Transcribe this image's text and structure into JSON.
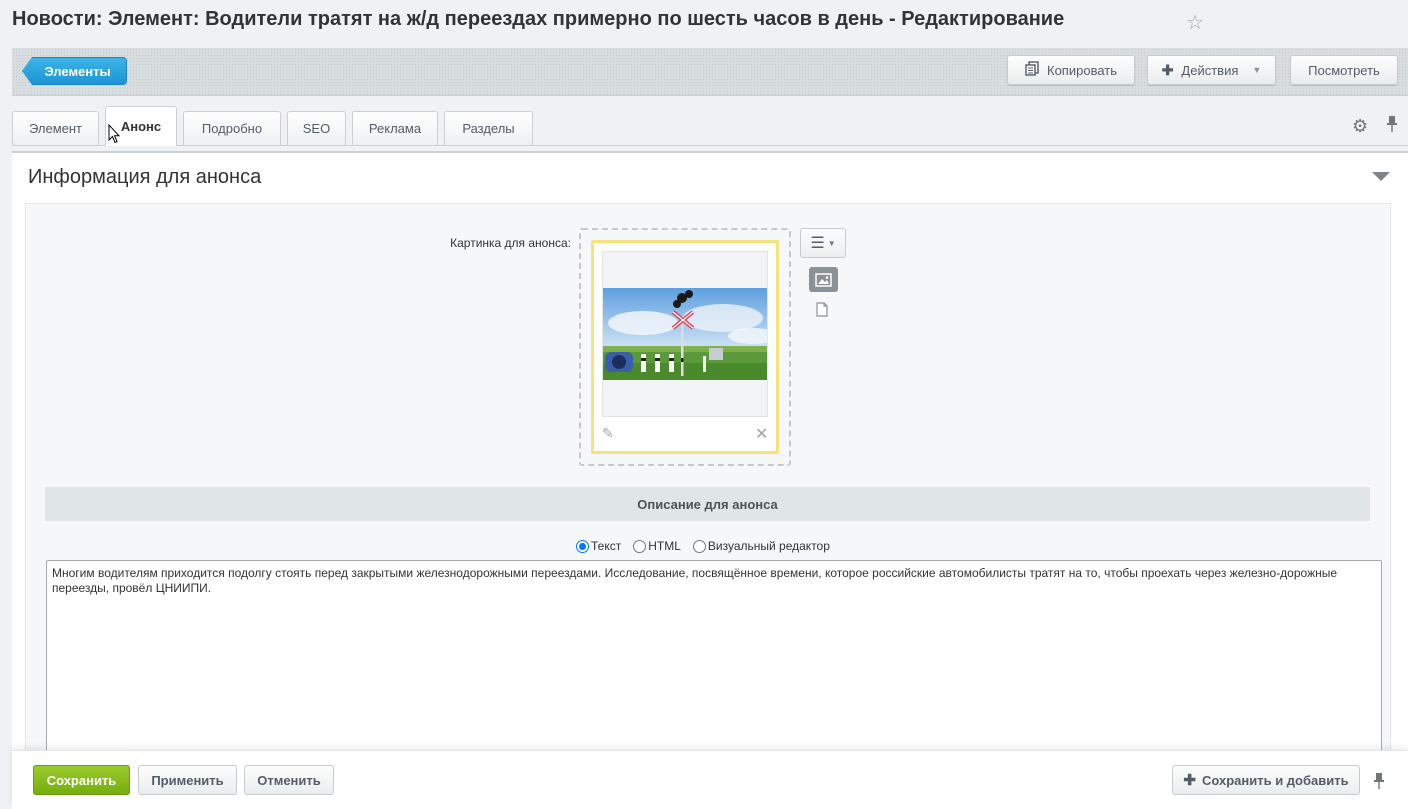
{
  "page": {
    "title": "Новости: Элемент: Водители тратят на ж/д переездах примерно по шесть часов в день - Редактирование",
    "favorite_icon": "star-icon"
  },
  "toolbar": {
    "elements_label": "Элементы",
    "copy_label": "Копировать",
    "actions_label": "Действия",
    "view_label": "Посмотреть"
  },
  "tabs": [
    {
      "label": "Элемент",
      "active": false
    },
    {
      "label": "Анонс",
      "active": true
    },
    {
      "label": "Подробно",
      "active": false
    },
    {
      "label": "SEO",
      "active": false
    },
    {
      "label": "Реклама",
      "active": false
    },
    {
      "label": "Разделы",
      "active": false
    }
  ],
  "section": {
    "title": "Информация для анонса",
    "picture_label": "Картинка для анонса:",
    "description_header": "Описание для анонса",
    "editor_modes": [
      {
        "label": "Текст",
        "checked": true
      },
      {
        "label": "HTML",
        "checked": false
      },
      {
        "label": "Визуальный редактор",
        "checked": false
      }
    ],
    "description_text": "Многим водителям приходится подолгу стоять перед закрытыми железнодорожными переездами. Исследование, посвящённое времени, которое российские автомобилисты тратят на то, чтобы проехать через железно-дорожные переезды, провёл ЦНИИПИ."
  },
  "footer": {
    "save_label": "Сохранить",
    "apply_label": "Применить",
    "cancel_label": "Отменить",
    "save_add_label": "Сохранить и добавить"
  },
  "colors": {
    "accent_blue": "#1e95d4",
    "save_green": "#76ad0f",
    "picture_border": "#f6e37a"
  }
}
